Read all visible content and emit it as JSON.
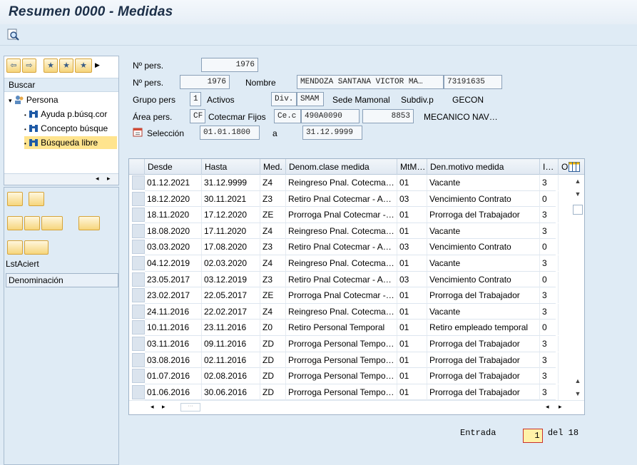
{
  "window": {
    "title": "Resumen 0000 - Medidas"
  },
  "toolbar": {
    "icons": [
      "find-icon"
    ]
  },
  "nav": {
    "buscar_label": "Buscar",
    "tree": [
      {
        "label": "Persona",
        "icon": "person-icon"
      },
      {
        "label": "Ayuda p.búsq.cor",
        "icon": "binoculars-icon"
      },
      {
        "label": "Concepto búsque",
        "icon": "binoculars-icon"
      },
      {
        "label": "Búsqueda libre",
        "icon": "binoculars-icon",
        "selected": true
      }
    ],
    "lst_label": "LstAciert",
    "denom_header": "Denominación"
  },
  "header": {
    "npers_label": "Nº pers.",
    "npers_value": "1976",
    "npers2_label": "Nº pers.",
    "npers2_value": "1976",
    "nombre_label": "Nombre",
    "nombre_value": "MENDOZA SANTANA VICTOR MA…",
    "nombre_id": "73191635",
    "grupo_label": "Grupo pers",
    "grupo_value": "1",
    "grupo_text": "Activos",
    "div_label": "Div.",
    "div_value": "SMAM",
    "div_text": "Sede Mamonal",
    "subdiv_label": "Subdiv.p",
    "subdiv_text": "GECON",
    "area_label": "Área pers.",
    "area_value": "CF",
    "area_text": "Cotecmar Fijos",
    "cec_label": "Ce.c",
    "cec_value": "490A0090",
    "num_value": "8853",
    "puesto_text": "MECANICO NAV…",
    "seleccion_label": "Selección",
    "sel_from": "01.01.1800",
    "a_label": "a",
    "sel_to": "31.12.9999"
  },
  "table": {
    "columns": [
      "Desde",
      "Hasta",
      "Med.",
      "Denom.clase medida",
      "MtM…",
      "Den.motivo medida",
      "I…",
      "O"
    ],
    "rows": [
      [
        "01.12.2021",
        "31.12.9999",
        "Z4",
        "Reingreso Pnal. Cotecma…",
        "01",
        "Vacante",
        "3"
      ],
      [
        "18.12.2020",
        "30.11.2021",
        "Z3",
        "Retiro Pnal Cotecmar - A…",
        "03",
        "Vencimiento Contrato",
        "0"
      ],
      [
        "18.11.2020",
        "17.12.2020",
        "ZE",
        "Prorroga Pnal Cotecmar -…",
        "01",
        "Prorroga del Trabajador",
        "3"
      ],
      [
        "18.08.2020",
        "17.11.2020",
        "Z4",
        "Reingreso Pnal. Cotecma…",
        "01",
        "Vacante",
        "3"
      ],
      [
        "03.03.2020",
        "17.08.2020",
        "Z3",
        "Retiro Pnal Cotecmar - A…",
        "03",
        "Vencimiento Contrato",
        "0"
      ],
      [
        "04.12.2019",
        "02.03.2020",
        "Z4",
        "Reingreso Pnal. Cotecma…",
        "01",
        "Vacante",
        "3"
      ],
      [
        "23.05.2017",
        "03.12.2019",
        "Z3",
        "Retiro Pnal Cotecmar - A…",
        "03",
        "Vencimiento Contrato",
        "0"
      ],
      [
        "23.02.2017",
        "22.05.2017",
        "ZE",
        "Prorroga Pnal Cotecmar -…",
        "01",
        "Prorroga del Trabajador",
        "3"
      ],
      [
        "24.11.2016",
        "22.02.2017",
        "Z4",
        "Reingreso Pnal. Cotecma…",
        "01",
        "Vacante",
        "3"
      ],
      [
        "10.11.2016",
        "23.11.2016",
        "Z0",
        "Retiro Personal Temporal",
        "01",
        "Retiro empleado temporal",
        "0"
      ],
      [
        "03.11.2016",
        "09.11.2016",
        "ZD",
        "Prorroga Personal Tempo…",
        "01",
        "Prorroga del Trabajador",
        "3"
      ],
      [
        "03.08.2016",
        "02.11.2016",
        "ZD",
        "Prorroga Personal Tempo…",
        "01",
        "Prorroga del Trabajador",
        "3"
      ],
      [
        "01.07.2016",
        "02.08.2016",
        "ZD",
        "Prorroga Personal Tempo…",
        "01",
        "Prorroga del Trabajador",
        "3"
      ],
      [
        "01.06.2016",
        "30.06.2016",
        "ZD",
        "Prorroga Personal Tempo…",
        "01",
        "Prorroga del Trabajador",
        "3"
      ]
    ]
  },
  "pager": {
    "label": "Entrada",
    "current": "1",
    "of_label": "del",
    "total": "18"
  }
}
